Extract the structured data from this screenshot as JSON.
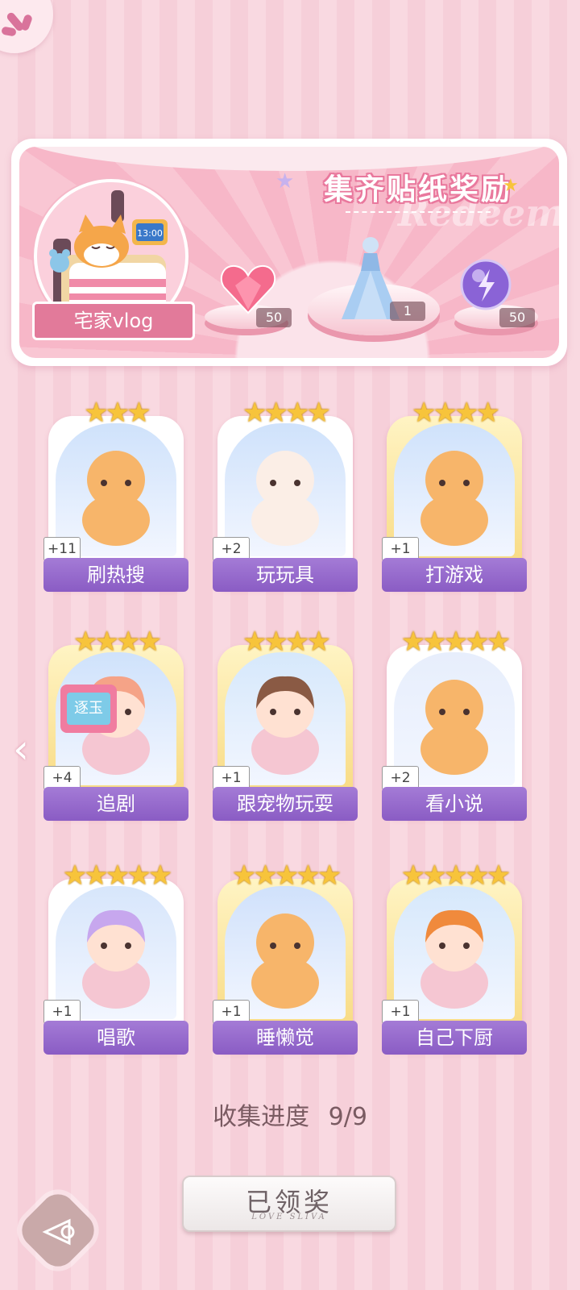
{
  "banner": {
    "title": "集齐贴纸奖励",
    "watermark": "Redeem",
    "album_label": "宅家vlog",
    "rewards": [
      {
        "icon": "pink-heart-gem-icon",
        "count": "50"
      },
      {
        "icon": "blue-gown-outfit-icon",
        "count": "1"
      },
      {
        "icon": "purple-energy-orb-icon",
        "count": "50"
      }
    ]
  },
  "cards": [
    {
      "label": "刷热搜",
      "count": "+11",
      "stars": 3,
      "frame": "white",
      "icon": "cat-with-phone-icon"
    },
    {
      "label": "玩玩具",
      "count": "+2",
      "stars": 4,
      "frame": "white",
      "icon": "bunny-with-toys-icon"
    },
    {
      "label": "打游戏",
      "count": "+1",
      "stars": 4,
      "frame": "gold",
      "icon": "cat-with-console-icon"
    },
    {
      "label": "追剧",
      "count": "+4",
      "stars": 4,
      "frame": "gold",
      "icon": "girl-watching-tv-icon"
    },
    {
      "label": "跟宠物玩耍",
      "count": "+1",
      "stars": 4,
      "frame": "gold",
      "icon": "girl-with-fishbowl-icon"
    },
    {
      "label": "看小说",
      "count": "+2",
      "stars": 5,
      "frame": "white",
      "icon": "cat-reading-book-icon"
    },
    {
      "label": "唱歌",
      "count": "+1",
      "stars": 5,
      "frame": "white",
      "icon": "girl-singing-icon"
    },
    {
      "label": "睡懒觉",
      "count": "+1",
      "stars": 5,
      "frame": "gold",
      "icon": "dog-sleeping-icon"
    },
    {
      "label": "自己下厨",
      "count": "+1",
      "stars": 5,
      "frame": "gold",
      "icon": "girl-cooking-icon"
    }
  ],
  "tv_text": "逐玉",
  "alarm_clock": "13:00",
  "progress": {
    "label": "收集进度",
    "value": "9/9"
  },
  "claim_button": {
    "label": "已领奖",
    "subtext": "LOVE SLIVA"
  },
  "colors": {
    "accent_pink": "#e27a9a",
    "label_purple": "#8a5cc4",
    "star_gold": "#f7c43b"
  }
}
